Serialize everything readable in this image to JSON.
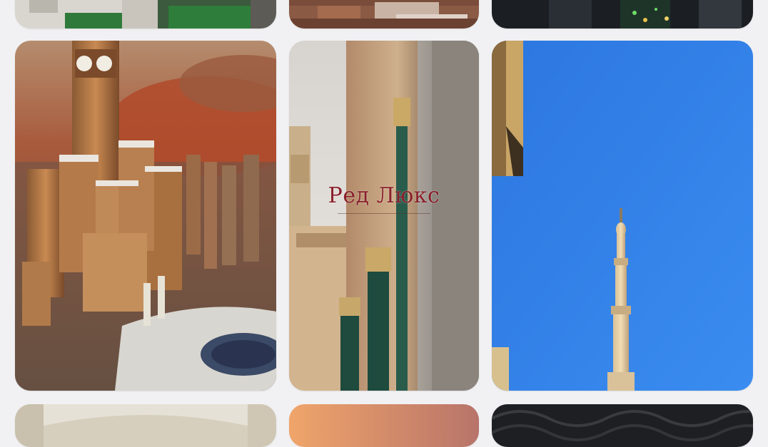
{
  "gallery": {
    "featured_watermark": "Ред Люкс",
    "tiles": [
      {
        "icon": "mosque-green-roof-photo"
      },
      {
        "icon": "city-rooftops-photo"
      },
      {
        "icon": "night-city-lights-photo"
      },
      {
        "icon": "clock-tower-aerial-photo"
      },
      {
        "icon": "tower-facade-columns-photo"
      },
      {
        "icon": "minaret-blue-sky-photo"
      },
      {
        "icon": "ceiling-arch-photo"
      },
      {
        "icon": "sunset-gradient-photo"
      },
      {
        "icon": "dark-pattern-photo"
      }
    ]
  },
  "colors": {
    "background": "#f1f1f3",
    "watermark": "#8a1f2b",
    "sky": "#2f7fe6"
  }
}
